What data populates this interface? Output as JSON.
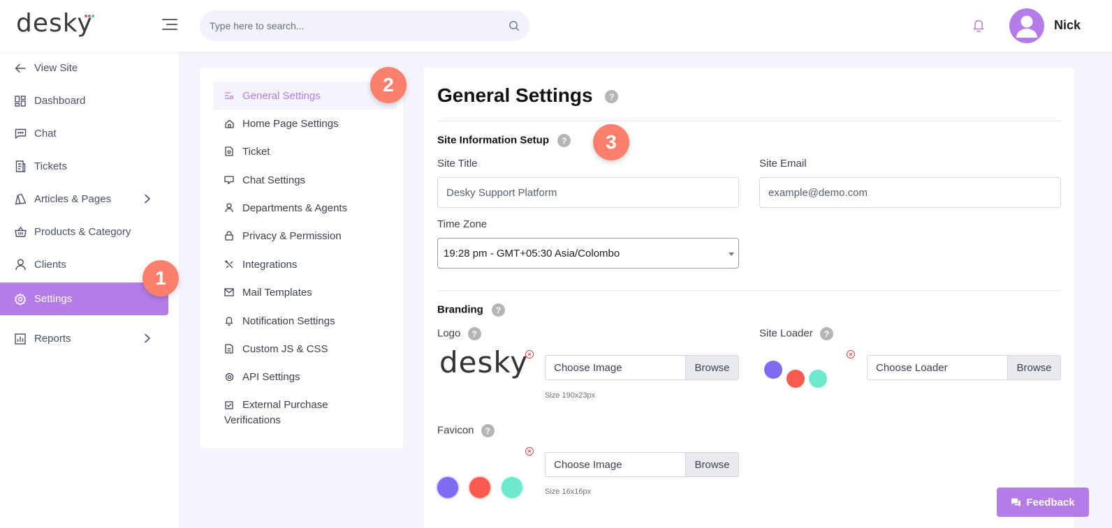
{
  "header": {
    "logo_text": "desky",
    "search_placeholder": "Type here to search...",
    "user_name": "Nick"
  },
  "sidebar": {
    "items": [
      {
        "label": "View Site",
        "icon": "arrow-left-icon"
      },
      {
        "label": "Dashboard",
        "icon": "dashboard-icon"
      },
      {
        "label": "Chat",
        "icon": "chat-icon"
      },
      {
        "label": "Tickets",
        "icon": "tickets-icon"
      },
      {
        "label": "Articles & Pages",
        "icon": "articles-icon"
      },
      {
        "label": "Products & Category",
        "icon": "basket-icon"
      },
      {
        "label": "Clients",
        "icon": "user-icon"
      },
      {
        "label": "Settings",
        "icon": "gear-icon"
      },
      {
        "label": "Reports",
        "icon": "reports-icon"
      }
    ]
  },
  "callouts": [
    "1",
    "2",
    "3"
  ],
  "settings_menu": {
    "items": [
      {
        "label": "General Settings",
        "icon": "sliders-icon"
      },
      {
        "label": "Home Page Settings",
        "icon": "home-icon"
      },
      {
        "label": "Ticket",
        "icon": "ticket-icon"
      },
      {
        "label": "Chat Settings",
        "icon": "chat-icon"
      },
      {
        "label": "Departments & Agents",
        "icon": "user-icon"
      },
      {
        "label": "Privacy & Permission",
        "icon": "lock-icon"
      },
      {
        "label": "Integrations",
        "icon": "tools-icon"
      },
      {
        "label": "Mail Templates",
        "icon": "mail-icon"
      },
      {
        "label": "Notification Settings",
        "icon": "bell-icon"
      },
      {
        "label": "Custom JS & CSS",
        "icon": "file-icon"
      },
      {
        "label": "API Settings",
        "icon": "gear-icon"
      },
      {
        "label": "External Purchase Verifications",
        "icon": "checkbox-icon"
      }
    ]
  },
  "main": {
    "title": "General Settings",
    "help_glyph": "?",
    "site_info": {
      "title": "Site Information Setup",
      "site_title_label": "Site Title",
      "site_title_value": "Desky Support Platform",
      "site_email_label": "Site Email",
      "site_email_value": "example@demo.com",
      "timezone_label": "Time Zone",
      "timezone_value": "19:28 pm - GMT+05:30 Asia/Colombo"
    },
    "branding": {
      "title": "Branding",
      "logo_label": "Logo",
      "logo_preview_text": "desky",
      "logo_file_placeholder": "Choose Image",
      "logo_size": "Size 190x23px",
      "loader_label": "Site Loader",
      "loader_file_placeholder": "Choose Loader",
      "favicon_label": "Favicon",
      "favicon_file_placeholder": "Choose Image",
      "favicon_size": "Size 16x16px",
      "browse_label": "Browse",
      "remove_glyph": "×"
    }
  },
  "feedback_label": "Feedback",
  "colors": {
    "accent": "#b57be8",
    "callout": "#fb7f6d",
    "loader_purple": "#7f6cf4",
    "loader_red": "#fb5b4e",
    "loader_teal": "#6ee8cf"
  }
}
